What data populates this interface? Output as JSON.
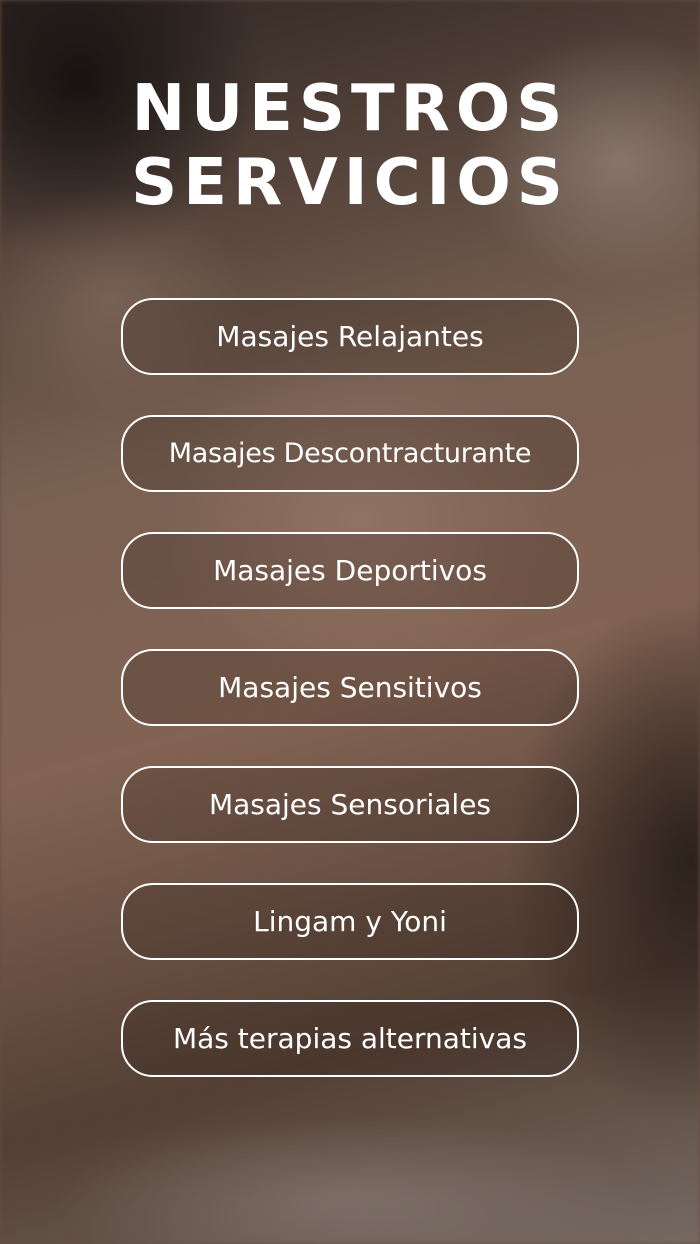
{
  "header": {
    "title_line1": "NUESTROS",
    "title_line2": "SERVICIOS"
  },
  "services": [
    {
      "label": "Masajes Relajantes"
    },
    {
      "label": "Masajes Descontracturante"
    },
    {
      "label": "Masajes Deportivos"
    },
    {
      "label": "Masajes Sensitivos"
    },
    {
      "label": "Masajes Sensoriales"
    },
    {
      "label": "Lingam y Yoni"
    },
    {
      "label": "Más terapias alternativas"
    }
  ],
  "colors": {
    "text": "#ffffff",
    "button_border": "#ffffff"
  },
  "background": {
    "description_icon": "massage-photo"
  }
}
